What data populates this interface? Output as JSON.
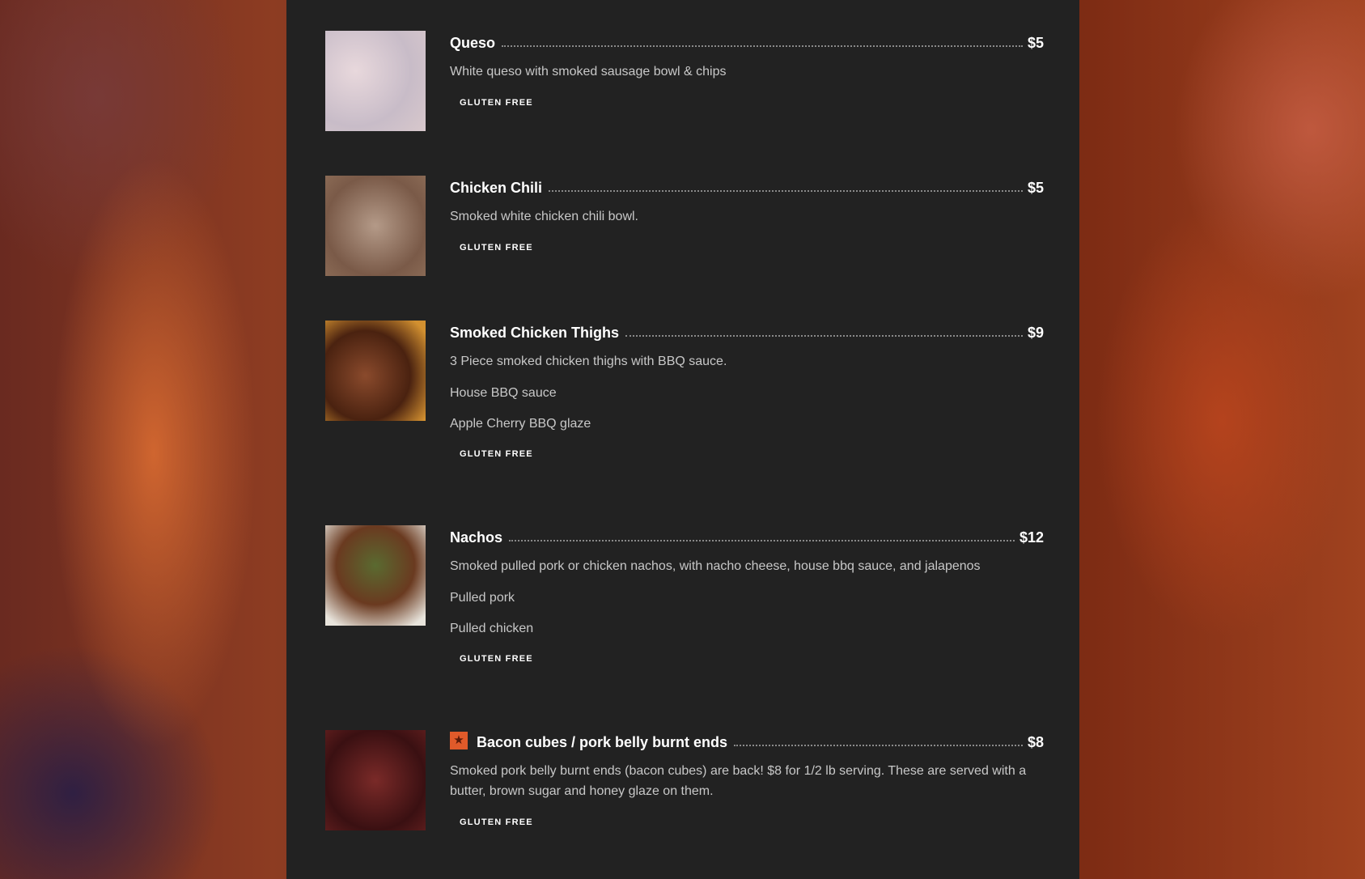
{
  "menu": {
    "items": [
      {
        "name": "Queso",
        "price": "$5",
        "description": "White queso with smoked sausage bowl & chips",
        "options": [],
        "tag": "GLUTEN FREE",
        "featured": false,
        "image": "queso-photo"
      },
      {
        "name": "Chicken Chili",
        "price": "$5",
        "description": "Smoked white chicken chili bowl.",
        "options": [],
        "tag": "GLUTEN FREE",
        "featured": false,
        "image": "chicken-chili-photo"
      },
      {
        "name": "Smoked Chicken Thighs",
        "price": "$9",
        "description": "3 Piece smoked chicken thighs with BBQ sauce.",
        "options": [
          "House BBQ sauce",
          "Apple Cherry BBQ glaze"
        ],
        "tag": "GLUTEN FREE",
        "featured": false,
        "image": "chicken-thighs-photo"
      },
      {
        "name": "Nachos",
        "price": "$12",
        "description": "Smoked pulled pork or chicken nachos, with nacho cheese, house bbq sauce, and jalapenos",
        "options": [
          "Pulled pork",
          "Pulled chicken"
        ],
        "tag": "GLUTEN FREE",
        "featured": false,
        "image": "nachos-photo"
      },
      {
        "name": "Bacon cubes / pork belly burnt ends",
        "price": "$8",
        "description": "Smoked pork belly burnt ends (bacon cubes) are back! $8 for 1/2 lb serving. These are served with a butter, brown sugar and honey glaze on them.",
        "options": [],
        "tag": "GLUTEN FREE",
        "featured": true,
        "featured_icon": "star-icon",
        "image": "burnt-ends-photo"
      }
    ]
  },
  "colors": {
    "panel": "#222222",
    "accent": "#e05a2a",
    "text_primary": "#ffffff",
    "text_secondary": "#c8c8c8"
  }
}
